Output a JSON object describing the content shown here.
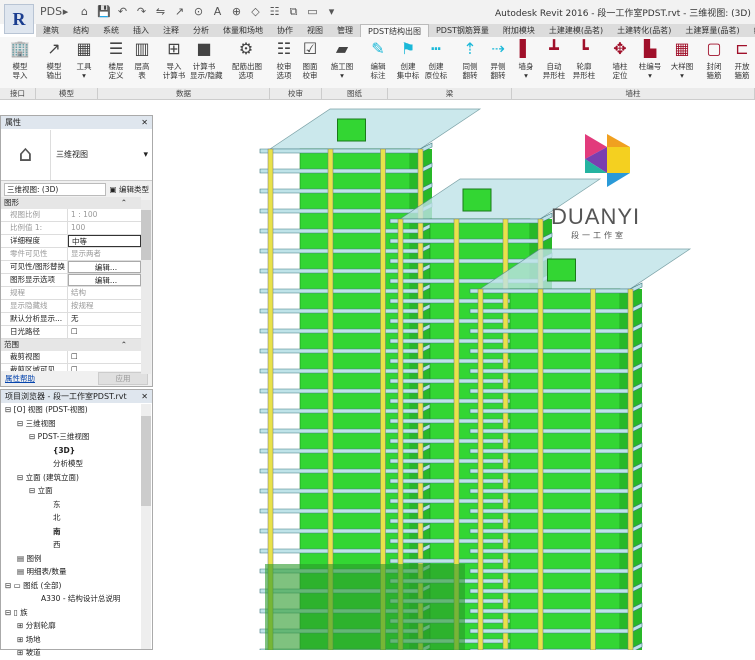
{
  "titlebar": {
    "title": "Autodesk Revit 2016 -    段一工作室PDST.rvt - 三维视图: (3D)",
    "app_letter": "R",
    "qat": [
      "PDS",
      "▸",
      "⌂",
      "💾",
      "↶",
      "↷",
      "⇋",
      "↗",
      "⊙",
      "A",
      "⊕",
      "◇",
      "☷",
      "⧉",
      "▭",
      "▾"
    ]
  },
  "tabs": [
    "建筑",
    "结构",
    "系统",
    "插入",
    "注释",
    "分析",
    "体量和场地",
    "协作",
    "视图",
    "管理",
    "PDST结构出图",
    "PDST钢筋算量",
    "附加模块",
    "土建建模(品茗)",
    "土建转化(品茗)",
    "土建算量(品茗)",
    "给排水("
  ],
  "ribbon": {
    "buttons": [
      {
        "label": "模型\n导入",
        "icon": "building-import-icon",
        "glyph": "🏢"
      },
      {
        "label": "模型\n输出",
        "icon": "export-icon",
        "glyph": "↗"
      },
      {
        "label": "工具\n▾",
        "icon": "tools-icon",
        "glyph": "▦"
      },
      {
        "label": "楼层\n定义",
        "icon": "floor-define-icon",
        "glyph": "☰"
      },
      {
        "label": "层高\n表",
        "icon": "floor-height-icon",
        "glyph": "▥"
      },
      {
        "label": "导入\n计算书",
        "icon": "import-calc-icon",
        "glyph": "⊞"
      },
      {
        "label": "计算书\n显示/隐藏",
        "icon": "calc-toggle-icon",
        "glyph": "■"
      },
      {
        "label": "配筋出图\n选项",
        "icon": "gear-icon",
        "glyph": "⚙"
      },
      {
        "label": "校审\n选项",
        "icon": "check-options-icon",
        "glyph": "☷"
      },
      {
        "label": "图面\n校审",
        "icon": "checkbox-icon",
        "glyph": "☑"
      },
      {
        "label": "施工图\n▾",
        "icon": "drawing-icon",
        "glyph": "▰"
      },
      {
        "label": "编辑\n标注",
        "icon": "pencil-icon",
        "glyph": "✎"
      },
      {
        "label": "创建\n集中标",
        "icon": "beam-label-icon",
        "glyph": "⚑"
      },
      {
        "label": "创建\n原位标",
        "icon": "beam-inplace-icon",
        "glyph": "┅"
      },
      {
        "label": "同侧\n翻转",
        "icon": "flip-same-icon",
        "glyph": "⇡"
      },
      {
        "label": "异侧\n翻转",
        "icon": "flip-other-icon",
        "glyph": "⇢"
      },
      {
        "label": "墙身\n▾",
        "icon": "wall-icon",
        "glyph": "▌"
      },
      {
        "label": "自动\n异形柱",
        "icon": "auto-column-icon",
        "glyph": "┻"
      },
      {
        "label": "轮廓\n异形柱",
        "icon": "outline-column-icon",
        "glyph": "┗"
      },
      {
        "label": "墙柱\n定位",
        "icon": "locate-icon",
        "glyph": "✥"
      },
      {
        "label": "柱编号\n▾",
        "icon": "column-number-icon",
        "glyph": "▙"
      },
      {
        "label": "大样图\n▾",
        "icon": "detail-icon",
        "glyph": "▦"
      },
      {
        "label": "封闭\n箍筋",
        "icon": "closed-stirrup-icon",
        "glyph": "▢"
      },
      {
        "label": "开放\n箍筋",
        "icon": "open-stirrup-icon",
        "glyph": "⊏"
      }
    ],
    "panels": [
      "接口",
      "模型",
      "数据",
      "校审",
      "图纸",
      "梁",
      "墙柱"
    ]
  },
  "properties": {
    "title": "属性",
    "type_name": "三维视图",
    "selector": "三维视图: (3D)",
    "edit_type": "编辑类型",
    "groups": [
      {
        "name": "图形",
        "rows": [
          [
            "视图比例",
            "1 : 100",
            true
          ],
          [
            "比例值 1:",
            "100",
            true
          ],
          [
            "详细程度",
            "中等",
            false
          ],
          [
            "零件可见性",
            "显示两者",
            true
          ],
          [
            "可见性/图形替换",
            "编辑...",
            false
          ],
          [
            "图形显示选项",
            "编辑...",
            false
          ],
          [
            "规程",
            "结构",
            true
          ],
          [
            "显示隐藏线",
            "按规程",
            true
          ],
          [
            "默认分析显示...",
            "无",
            false
          ],
          [
            "日光路径",
            "☐",
            false
          ]
        ]
      },
      {
        "name": "范围",
        "rows": [
          [
            "裁剪视图",
            "☐",
            false
          ],
          [
            "裁剪区域可见",
            "☐",
            false
          ]
        ]
      }
    ],
    "help": "属性帮助",
    "apply": "应用"
  },
  "browser": {
    "title": "项目浏览器 - 段一工作室PDST.rvt",
    "items": [
      {
        "t": "⊟ [O] 视图 (PDST-视图)",
        "d": 0
      },
      {
        "t": "⊟ 三维视图",
        "d": 1
      },
      {
        "t": "⊟ PDST-三维视图",
        "d": 2
      },
      {
        "t": "{3D}",
        "d": 4,
        "b": true
      },
      {
        "t": "分析模型",
        "d": 4
      },
      {
        "t": "⊟ 立面 (建筑立面)",
        "d": 1
      },
      {
        "t": "⊟ 立面",
        "d": 2
      },
      {
        "t": "东",
        "d": 4
      },
      {
        "t": "北",
        "d": 4
      },
      {
        "t": "南",
        "d": 4,
        "b": true
      },
      {
        "t": "西",
        "d": 4
      },
      {
        "t": "▤ 图例",
        "d": 1
      },
      {
        "t": "▤ 明细表/数量",
        "d": 1
      },
      {
        "t": "⊟ ▭ 图纸 (全部)",
        "d": 0
      },
      {
        "t": "A330 - 结构设计总说明",
        "d": 3
      },
      {
        "t": "⊟ ▯ 族",
        "d": 0
      },
      {
        "t": "⊞ 分割轮廓",
        "d": 1
      },
      {
        "t": "⊞ 场地",
        "d": 1
      },
      {
        "t": "⊞ 坡道",
        "d": 1
      }
    ]
  },
  "logo": {
    "name": "DUANYI",
    "sub": "段一工作室"
  },
  "colors": {
    "green": "#33d633",
    "column": "#e8e24a",
    "slab": "#bfe3e8"
  }
}
